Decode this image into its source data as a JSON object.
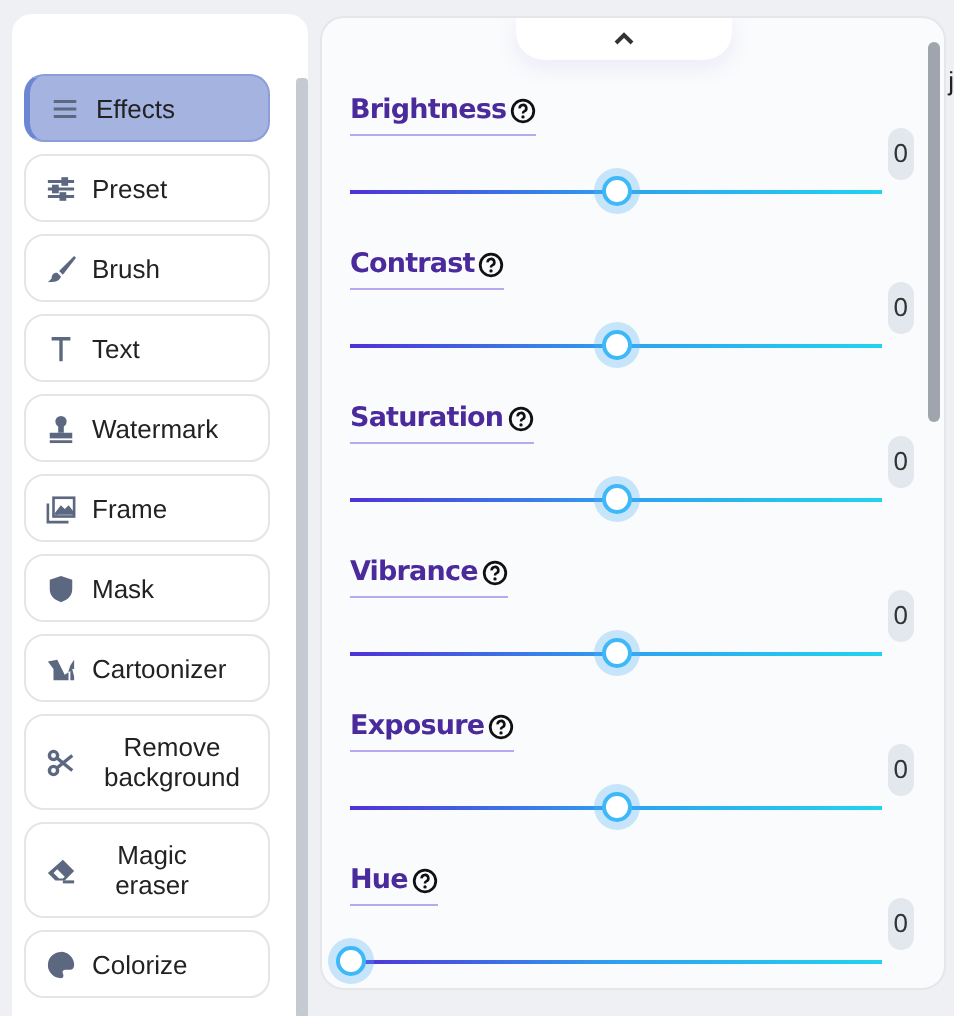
{
  "sidebar": {
    "items": [
      {
        "label": "Effects",
        "selected": true
      },
      {
        "label": "Preset",
        "selected": false
      },
      {
        "label": "Brush",
        "selected": false
      },
      {
        "label": "Text",
        "selected": false
      },
      {
        "label": "Watermark",
        "selected": false
      },
      {
        "label": "Frame",
        "selected": false
      },
      {
        "label": "Mask",
        "selected": false
      },
      {
        "label": "Cartoonizer",
        "selected": false
      },
      {
        "label": "Remove background",
        "selected": false
      },
      {
        "label": "Magic eraser",
        "selected": false
      },
      {
        "label": "Colorize",
        "selected": false
      }
    ]
  },
  "panel": {
    "sliders": [
      {
        "label": "Brightness",
        "value": "0",
        "level": 0.5
      },
      {
        "label": "Contrast",
        "value": "0",
        "level": 0.5
      },
      {
        "label": "Saturation",
        "value": "0",
        "level": 0.5
      },
      {
        "label": "Vibrance",
        "value": "0",
        "level": 0.5
      },
      {
        "label": "Exposure",
        "value": "0",
        "level": 0.5
      },
      {
        "label": "Hue",
        "value": "0",
        "level": 0
      }
    ]
  },
  "edge_text": "j"
}
